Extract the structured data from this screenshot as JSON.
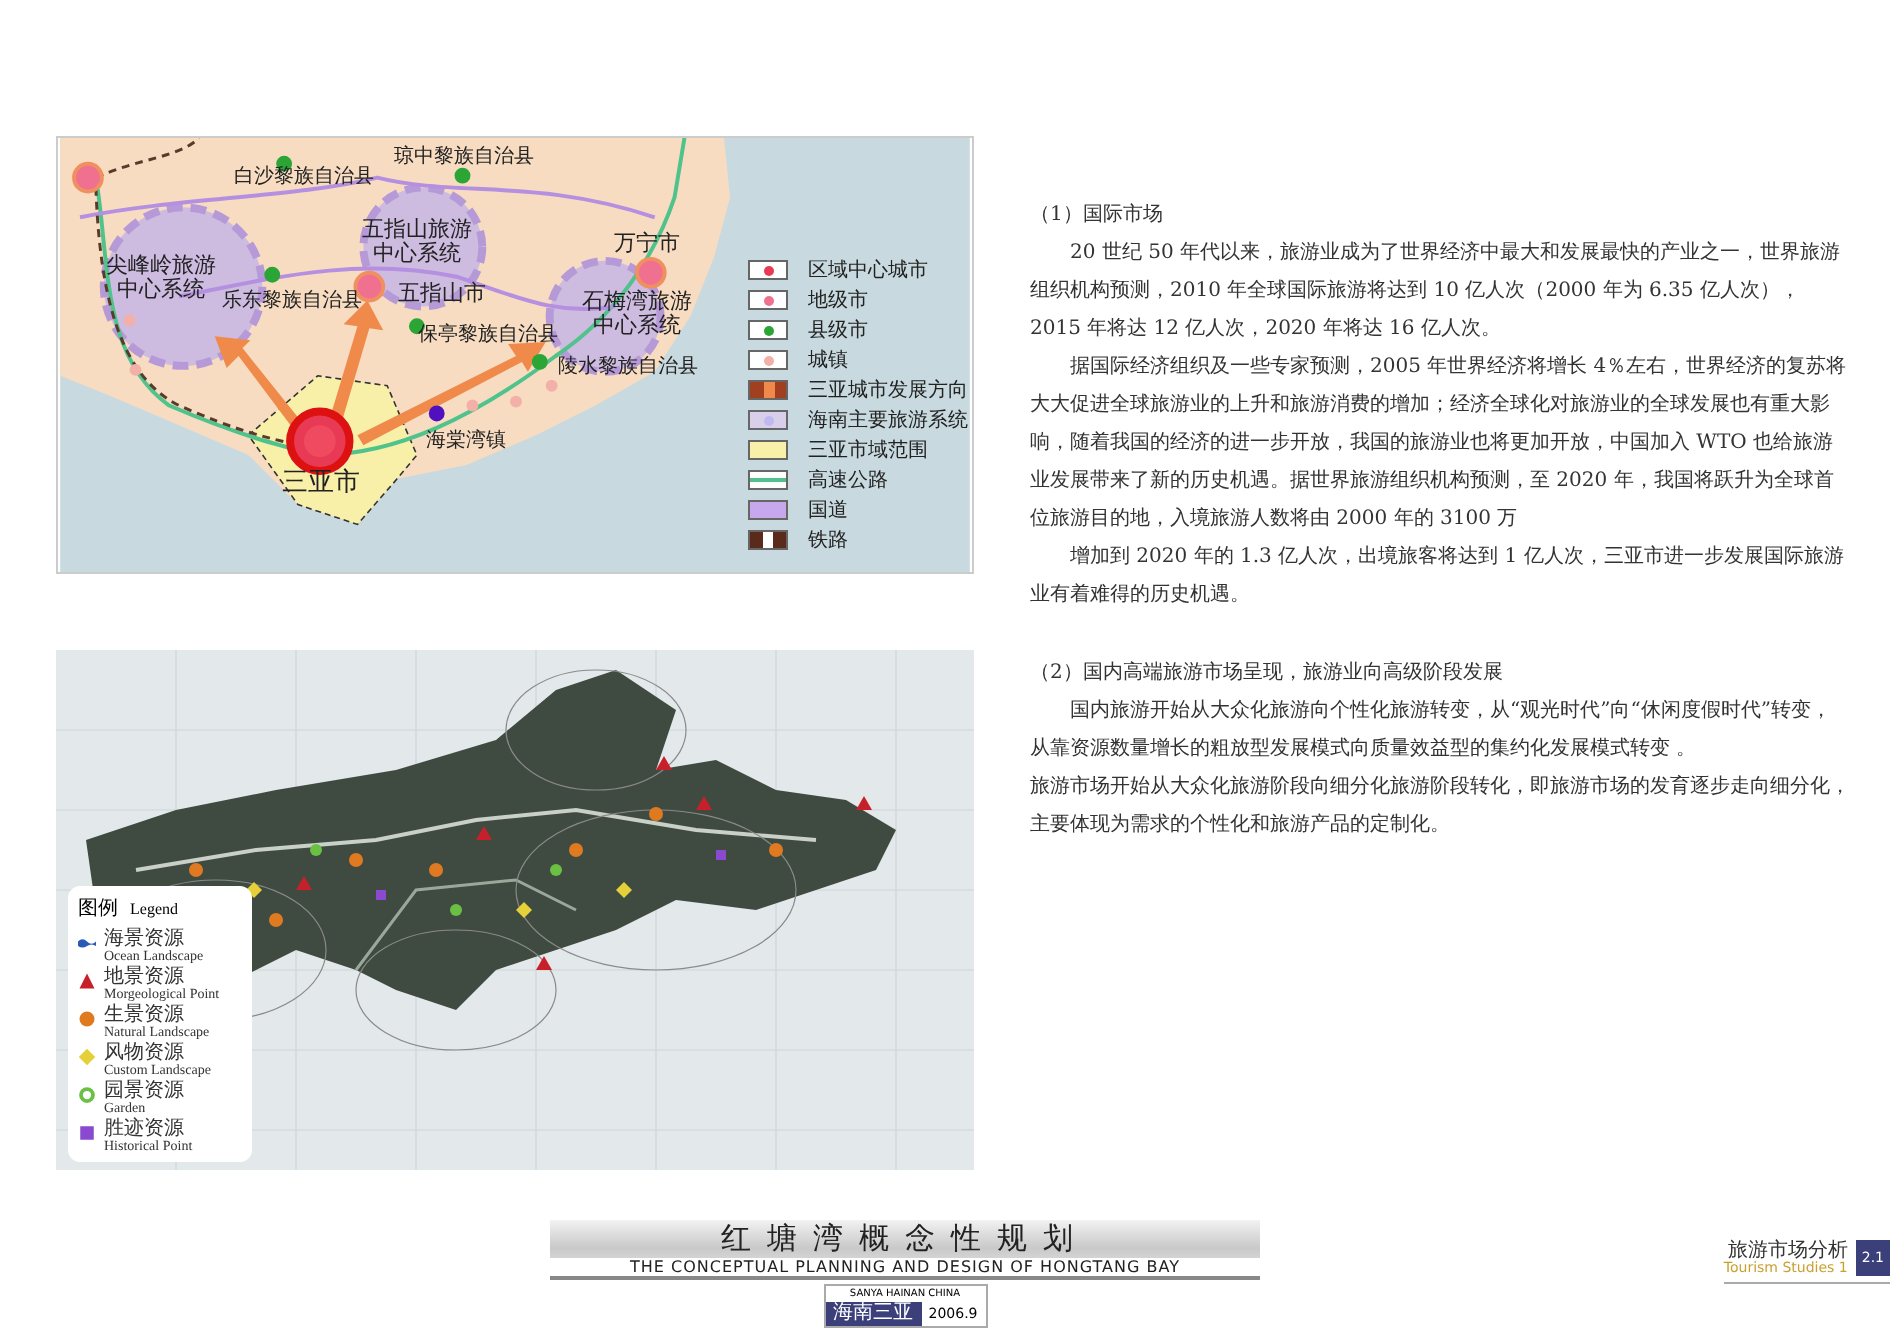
{
  "regional_map": {
    "labels": [
      {
        "kind": "county",
        "text": "琼中黎族自治县"
      },
      {
        "kind": "county",
        "text": "白沙黎族自治县"
      },
      {
        "kind": "system",
        "text": "尖峰岭旅游中心系统"
      },
      {
        "kind": "system",
        "text": "五指山旅游中心系统"
      },
      {
        "kind": "county",
        "text": "乐东黎族自治县"
      },
      {
        "kind": "city",
        "text": "五指山市"
      },
      {
        "kind": "city",
        "text": "万宁市"
      },
      {
        "kind": "county",
        "text": "保亭黎族自治县"
      },
      {
        "kind": "system",
        "text": "石梅湾旅游中心系统"
      },
      {
        "kind": "county",
        "text": "陵水黎族自治县"
      },
      {
        "kind": "county",
        "text": "海棠湾镇"
      },
      {
        "kind": "major",
        "text": "三亚市"
      }
    ],
    "legend": [
      {
        "kind": "regional-center",
        "label": "区域中心城市"
      },
      {
        "kind": "prefecture",
        "label": "地级市"
      },
      {
        "kind": "county",
        "label": "县级市"
      },
      {
        "kind": "town",
        "label": "城镇"
      },
      {
        "kind": "direction",
        "label": "三亚城市发展方向"
      },
      {
        "kind": "tourism",
        "label": "海南主要旅游系统"
      },
      {
        "kind": "area",
        "label": "三亚市域范围"
      },
      {
        "kind": "highway",
        "label": "高速公路"
      },
      {
        "kind": "national",
        "label": "国道"
      },
      {
        "kind": "railway",
        "label": "铁路"
      }
    ]
  },
  "market_text": {
    "sections": [
      {
        "heading": "（1）国际市场",
        "paragraphs": [
          {
            "indent": true,
            "text": "20 世纪 50 年代以来，旅游业成为了世界经济中最大和发展最快的产业之一，世界旅游组织机构预测，2010 年全球国际旅游将达到 10 亿人次（2000 年为 6.35 亿人次），2015 年将达 12 亿人次，2020 年将达 16 亿人次。"
          },
          {
            "indent": true,
            "text": "据国际经济组织及一些专家预测，2005 年世界经济将增长 4％左右，世界经济的复苏将大大促进全球旅游业的上升和旅游消费的增加；经济全球化对旅游业的全球发展也有重大影响，随着我国的经济的进一步开放，我国的旅游业也将更加开放，中国加入 WTO 也给旅游业发展带来了新的历史机遇。据世界旅游组织机构预测，至 2020 年，我国将跃升为全球首位旅游目的地，入境旅游人数将由 2000 年的 3100 万"
          },
          {
            "indent": true,
            "text": "增加到 2020 年的 1.3 亿人次，出境旅客将达到 1 亿人次，三亚市进一步发展国际旅游业有着难得的历史机遇。"
          }
        ]
      },
      {
        "heading": "（2）国内高端旅游市场呈现，旅游业向高级阶段发展",
        "paragraphs": [
          {
            "indent": true,
            "text": "国内旅游开始从大众化旅游向个性化旅游转变，从“观光时代”向“休闲度假时代”转变，从靠资源数量增长的粗放型发展模式向质量效益型的集约化发展模式转变 。"
          },
          {
            "indent": false,
            "text": "旅游市场开始从大众化旅游阶段向细分化旅游阶段转化，即旅游市场的发育逐步走向细分化，主要体现为需求的个性化和旅游产品的定制化。"
          }
        ]
      }
    ]
  },
  "resource_map": {
    "legend_title": "图例",
    "legend_title_en": "Legend",
    "legend": [
      {
        "kind": "ocean",
        "label": "海景资源",
        "label_en": "Ocean Landscape"
      },
      {
        "kind": "triangle",
        "label": "地景资源",
        "label_en": "Morgeological Point"
      },
      {
        "kind": "dot",
        "label": "生景资源",
        "label_en": "Natural Landscape"
      },
      {
        "kind": "diamond",
        "label": "风物资源",
        "label_en": "Custom Landscape"
      },
      {
        "kind": "ring",
        "label": "园景资源",
        "label_en": "Garden"
      },
      {
        "kind": "square",
        "label": "胜迹资源",
        "label_en": "Historical Point"
      }
    ]
  },
  "title_block": {
    "title": "红塘湾概念性规划",
    "subtitle": "THE CONCEPTUAL PLANNING AND DESIGN OF  HONGTANG BAY",
    "location_en": "SANYA HAINAN CHINA",
    "location": "海南三亚",
    "date": "2006.9"
  },
  "sheet_label": {
    "title": "旅游市场分析",
    "subtitle": "Tourism Studies 1",
    "number": "2.1"
  }
}
